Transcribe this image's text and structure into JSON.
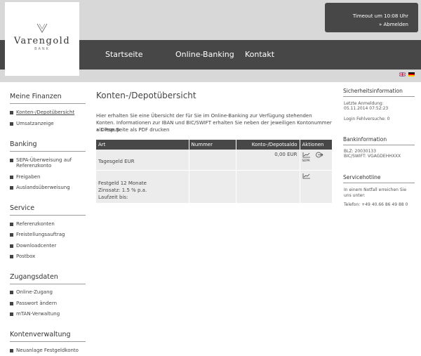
{
  "logo": {
    "name": "Varengold",
    "sub": "BANK"
  },
  "nav": {
    "home": "Startseite",
    "online": "Online-Banking",
    "contact": "Kontakt"
  },
  "session": {
    "timeout": "Timeout um 10:08 Uhr",
    "logout": "» Abmelden"
  },
  "sidebar": {
    "finances": {
      "title": "Meine Finanzen",
      "items": [
        "Konten-/Depotübersicht",
        "Umsatzanzeige"
      ]
    },
    "banking": {
      "title": "Banking",
      "items": [
        "SEPA-Überweisung auf Referenzkonto",
        "Freigaben",
        "Auslandsüberweisung"
      ]
    },
    "service": {
      "title": "Service",
      "items": [
        "Referenzkonten",
        "Freistellungsauftrag",
        "Downloadcenter",
        "Postbox"
      ]
    },
    "access": {
      "title": "Zugangsdaten",
      "items": [
        "Online-Zugang",
        "Passwort ändern",
        "mTAN-Verwaltung"
      ]
    },
    "accounts": {
      "title": "Kontenverwaltung",
      "items": [
        "Neuanlage Festgeldkonto"
      ]
    }
  },
  "main": {
    "title": "Konten-/Depotübersicht",
    "intro": "Hier erhalten Sie eine Übersicht der für Sie im Online-Banking zur Verfügung stehenden Konten. Informationen zur IBAN und BIC/SWIFT erhalten Sie neben der jeweiligen Kontonummer als Popup.",
    "pdf": "» Diese Seite als PDF drucken",
    "columns": {
      "art": "Art",
      "nummer": "Nummer",
      "saldo": "Konto-/Depotsaldo",
      "aktionen": "Aktionen"
    },
    "rows": [
      {
        "art": "Tagesgeld EUR",
        "nummer": "",
        "saldo": "0,00 EUR",
        "sepa": "SEPA"
      },
      {
        "art1": "Festgeld 12 Monate",
        "art2": "Zinssatz: 1.5 % p.a.",
        "art3": "Laufzeit bis:",
        "nummer": "",
        "saldo": ""
      }
    ]
  },
  "security": {
    "title": "Sicherheitsinformation",
    "last_login_label": "Letzte Anmeldung:",
    "last_login": "05.11.2014 07:52:23",
    "failed": "Login Fehlversuche: 0"
  },
  "bankinfo": {
    "title": "Bankinformation",
    "blz": "BLZ: 20030133",
    "bic": "BIC/SWIFT: VGAGDEHHXXX"
  },
  "hotline": {
    "title": "Servicehotline",
    "text": "In einem Notfall erreichen Sie uns unter:",
    "phone": "Telefon: +49 40.66 86 49 88 0"
  }
}
